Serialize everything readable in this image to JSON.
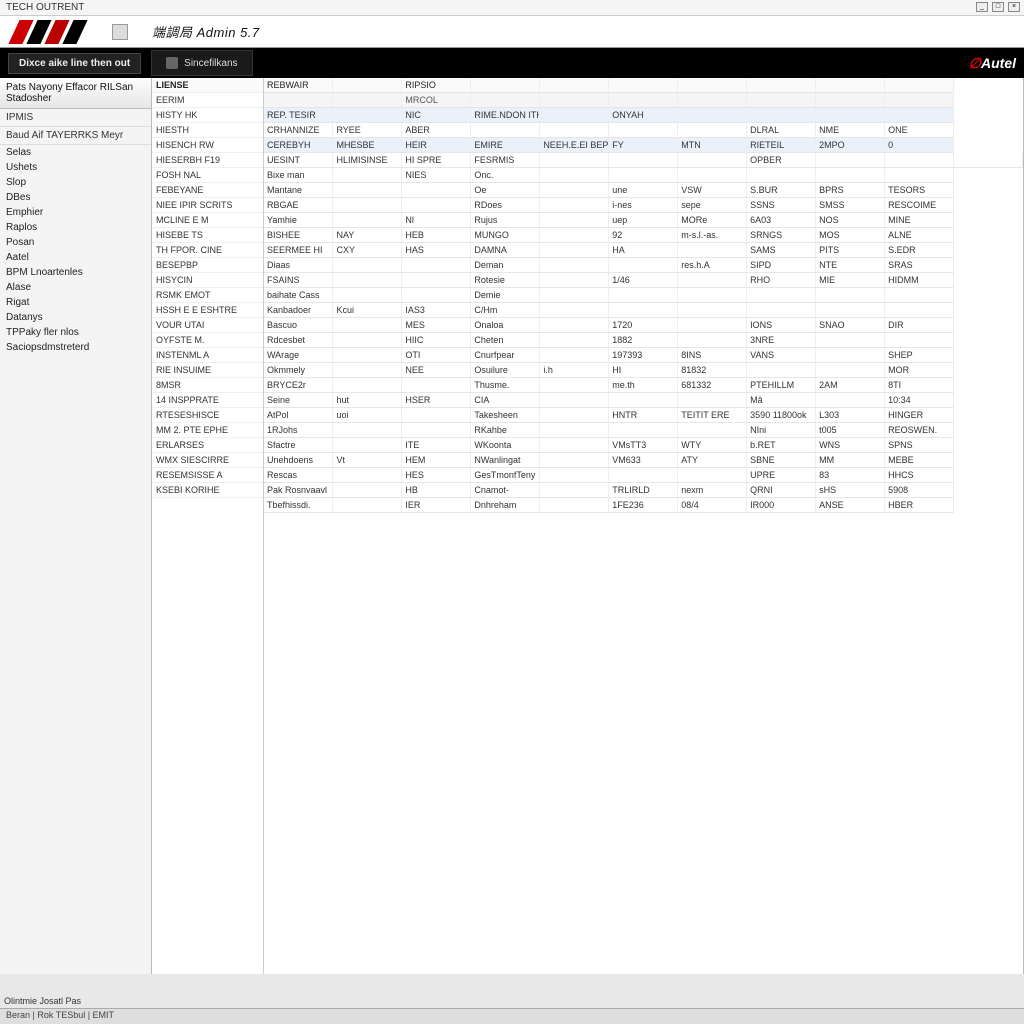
{
  "window": {
    "title": "TECH OUTRENT",
    "minimize": "_",
    "maximize": "□",
    "close": "×"
  },
  "brand": {
    "product": "端調局 Admin 5.7"
  },
  "topbar": {
    "left_button": "Dixce aike line then out",
    "tab_label": "Sincefilkans",
    "right_brand": "Autel"
  },
  "sidebar": {
    "header": "Pats Nayony Effacor RILSan Stadosher",
    "sub1": "IPMIS",
    "sub2": "Baud Aif TAYERRKS Meyr",
    "items": [
      "Selas",
      "Ushets",
      "Slop",
      "DBes",
      "Emphier",
      "Raplos",
      "Posan",
      "Aatel",
      "BPM Lnoartenles",
      "Alase",
      "Rigat",
      "Datanys",
      "TPPaky fler nlos",
      "Saciopsdmstreterd"
    ]
  },
  "leftlist": {
    "head": "LIENSE",
    "rows": [
      "EERIM",
      "HISTY HK",
      "HIESTH",
      "HISENCH RW",
      "HIESERBH F19",
      "FOSH NAL",
      "FEBEYANE",
      "NIEE IPIR SCRITS",
      "MCLINE E M",
      "HISEBE TS",
      "TH FPOR. CINE",
      "BESEPBP",
      "HISYCIN",
      "RSMK EMOT",
      "HSSH E E ESHTRE",
      "VOUR UTAI",
      "OYFSTE M.",
      "INSTENML A",
      "RIE INSUIME",
      "8MSR",
      "14 INSPPRATE",
      "RTESESHISCE",
      "MM 2. PTE EPHE",
      "ERLARSES",
      "WMX SIESCIRRE",
      "RESEMSISSE A",
      "KSEBI KORIHE"
    ]
  },
  "grid": {
    "headers": [
      "REBWAIR",
      "",
      "RIPSIO",
      "",
      "",
      "",
      "",
      "",
      "",
      ""
    ],
    "sub": [
      "",
      "",
      "MRCOL",
      "",
      "",
      "",
      "",
      "",
      "",
      ""
    ],
    "rows": [
      {
        "hl": true,
        "c": [
          "REP. TESIR",
          "",
          "NIC",
          "RIME.NDON ITHE BEE",
          "",
          "ONYAH",
          "",
          "",
          "",
          ""
        ]
      },
      {
        "hl": false,
        "c": [
          "CRHANNIZE",
          "RYEE",
          "ABER",
          "",
          "",
          "",
          "",
          "DLRAL",
          "NME",
          "ONE"
        ]
      },
      {
        "hl": true,
        "c": [
          "CEREBYH",
          "MHESBE",
          "HEIR",
          "EMIRE",
          "NEEH.E.EI BEPE",
          "FY",
          "MTN",
          "RIETEIL",
          "2MPO",
          "0"
        ]
      },
      {
        "hl": false,
        "c": [
          "UESINT",
          "HLIMISINSE",
          "HI SPRE",
          "FESRMIS",
          "",
          "",
          "",
          "OPBER",
          "",
          "",
          ""
        ]
      },
      {
        "hl": false,
        "c": [
          "Bixe man",
          "",
          "NIES",
          "Onc.",
          "",
          "",
          "",
          "",
          "",
          ""
        ]
      },
      {
        "hl": false,
        "c": [
          "Mantane",
          "",
          "",
          "Oe",
          "",
          "une",
          "VSW",
          "S.BUR",
          "BPRS",
          "TESORS"
        ]
      },
      {
        "hl": false,
        "c": [
          "RBGAE",
          "",
          "",
          "RDoes",
          "",
          "i-nes",
          "sepe",
          "SSNS",
          "SMSS",
          "RESCOIME"
        ]
      },
      {
        "hl": false,
        "c": [
          "Yamhie",
          "",
          "Nl",
          "Rujus",
          "",
          "uep",
          "MORe",
          "6A03",
          "NOS",
          "MINE"
        ]
      },
      {
        "hl": false,
        "c": [
          "BISHEE",
          "NAY",
          "HEB",
          "MUNGO",
          "",
          "92",
          "m-s.l.-as.",
          "SRNGS",
          "MOS",
          "ALNE"
        ]
      },
      {
        "hl": false,
        "c": [
          "SEERMEE HI",
          "CXY",
          "HAS",
          "DAMNA",
          "",
          "HA",
          "",
          "SAMS",
          "PITS",
          "S.EDR"
        ]
      },
      {
        "hl": false,
        "c": [
          "Diaas",
          "",
          "",
          "Deman",
          "",
          "",
          "res.h.A",
          "SIPD",
          "NTE",
          "SRAS"
        ]
      },
      {
        "hl": false,
        "c": [
          "FSAINS",
          "",
          "",
          "Rotesie",
          "",
          "1/46",
          "",
          "RHO",
          "MIE",
          "HIDMM"
        ]
      },
      {
        "hl": false,
        "c": [
          "baihate Cass",
          "",
          "",
          "Demie",
          "",
          "",
          "",
          "",
          "",
          ""
        ]
      },
      {
        "hl": false,
        "c": [
          "Kanbadoer",
          "Kcui",
          "IAS3",
          "C/Hm",
          "",
          "",
          "",
          "",
          "",
          ""
        ]
      },
      {
        "hl": false,
        "c": [
          "Bascuo",
          "",
          "MES",
          "Onaloa",
          "",
          "1720",
          "",
          "IONS",
          "SNAO",
          "DIR"
        ]
      },
      {
        "hl": false,
        "c": [
          "Rdcesbet",
          "",
          "HIIC",
          "Cheten",
          "",
          "1882",
          "",
          "3NRE",
          "",
          ""
        ]
      },
      {
        "hl": false,
        "c": [
          "WArage",
          "",
          "OTI",
          "Cnurfpear",
          "",
          "197393",
          "8INS",
          "VANS",
          "",
          "SHEP"
        ]
      },
      {
        "hl": false,
        "c": [
          "Okmmely",
          "",
          "NEE",
          "Osuilure",
          "i.h",
          "HI",
          "81832",
          "",
          "",
          "MOR"
        ]
      },
      {
        "hl": false,
        "c": [
          "BRYCE2r",
          "",
          "",
          "Thusme.",
          "",
          "me.th",
          "681332",
          "PTEHILLM",
          "2AM",
          "8TI"
        ]
      },
      {
        "hl": false,
        "c": [
          "Seine",
          "hut",
          "HSER",
          "CIA",
          "",
          "",
          "",
          "Mâ",
          "",
          "10:34"
        ]
      },
      {
        "hl": false,
        "c": [
          "AtPol",
          "uoi",
          "",
          "Takesheen",
          "",
          "HNTR",
          "TEITIT ERE",
          "3590 11800ok",
          "L303",
          "HINGER"
        ]
      },
      {
        "hl": false,
        "c": [
          "1RJohs",
          "",
          "",
          "RKahbe",
          "",
          "",
          "",
          "NIni",
          "t005",
          "REOSWEN."
        ]
      },
      {
        "hl": false,
        "c": [
          "Sfactre",
          "",
          "ITE",
          "WKoonta",
          "",
          "VMsTT3",
          "WTY",
          "b.RET",
          "WNS",
          "SPNS"
        ]
      },
      {
        "hl": false,
        "c": [
          "Unehdoens",
          "Vt",
          "HEM",
          "NWanlingat",
          "",
          "VM633",
          "ATY",
          "SBNE",
          "MM",
          "MEBE"
        ]
      },
      {
        "hl": false,
        "c": [
          "Rescas",
          "",
          "HES",
          "GesTmonfTeny",
          "",
          "",
          "",
          "UPRE",
          "83",
          "HHCS"
        ]
      },
      {
        "hl": false,
        "c": [
          "Pak Rosnvaavl",
          "",
          "HB",
          "Cnamot-",
          "",
          "TRLIRLD",
          "nexm",
          "QRNI",
          "sHS",
          "5908"
        ]
      },
      {
        "hl": false,
        "c": [
          "Tbefhissdi.",
          "",
          "IER",
          "Dnhreham",
          "",
          "1FE236",
          "08/4",
          "IR000",
          "ANSE",
          "HBER"
        ]
      }
    ]
  },
  "footer": {
    "text": "Olintmie Josatl Pas"
  },
  "statusbar": {
    "text": "Beran | Rok TESbul | EMIT"
  }
}
